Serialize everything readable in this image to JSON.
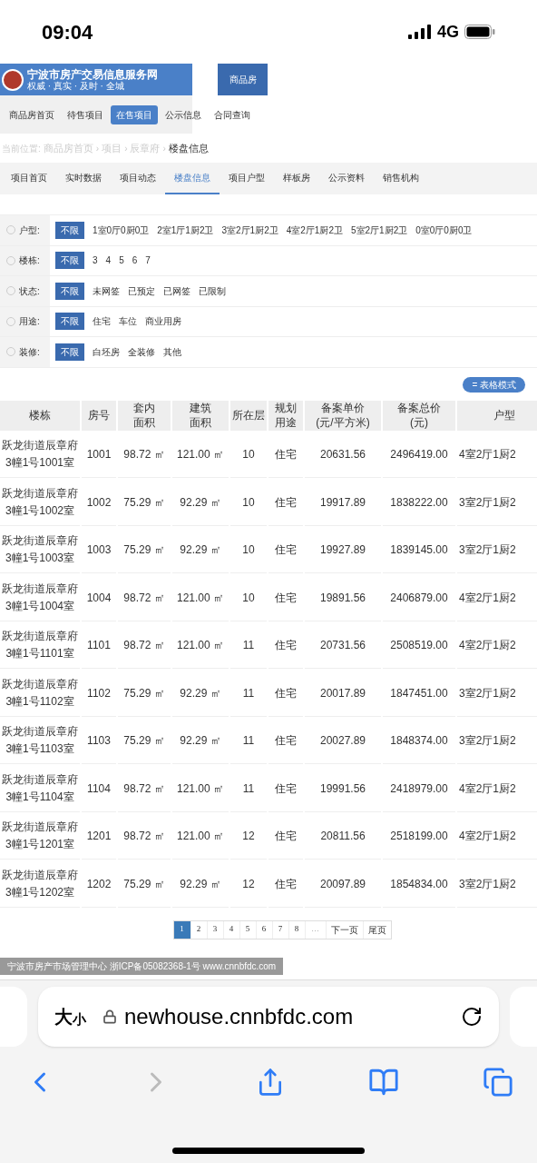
{
  "status_bar": {
    "time": "09:04",
    "network": "4G"
  },
  "site_header": {
    "title": "宁波市房产交易信息服务网",
    "slogan": "权威 · 真实 · 及时 · 全城",
    "nav_tab": "商品房"
  },
  "main_nav": [
    {
      "label": "商品房首页",
      "selected": false
    },
    {
      "label": "待售项目",
      "selected": false
    },
    {
      "label": "在售项目",
      "selected": true
    },
    {
      "label": "公示信息",
      "selected": false
    },
    {
      "label": "合同查询",
      "selected": false
    }
  ],
  "breadcrumb": {
    "prefix": "当前位置:",
    "separator": "›",
    "items": [
      "商品房首页",
      "项目",
      "辰章府",
      "楼盘信息"
    ]
  },
  "project_tabs": [
    {
      "label": "项目首页",
      "selected": false
    },
    {
      "label": "实时数据",
      "selected": false
    },
    {
      "label": "项目动态",
      "selected": false
    },
    {
      "label": "楼盘信息",
      "selected": true
    },
    {
      "label": "项目户型",
      "selected": false
    },
    {
      "label": "样板房",
      "selected": false
    },
    {
      "label": "公示资料",
      "selected": false
    },
    {
      "label": "销售机构",
      "selected": false
    }
  ],
  "filters": [
    {
      "label": "户型:",
      "options": [
        {
          "label": "不限",
          "selected": true
        },
        {
          "label": "1室0厅0厨0卫",
          "selected": false
        },
        {
          "label": "2室1厅1厨2卫",
          "selected": false
        },
        {
          "label": "3室2厅1厨2卫",
          "selected": false
        },
        {
          "label": "4室2厅1厨2卫",
          "selected": false
        },
        {
          "label": "5室2厅1厨2卫",
          "selected": false
        },
        {
          "label": "0室0厅0厨0卫",
          "selected": false
        }
      ]
    },
    {
      "label": "楼栋:",
      "options": [
        {
          "label": "不限",
          "selected": true
        },
        {
          "label": "3",
          "selected": false
        },
        {
          "label": "4",
          "selected": false
        },
        {
          "label": "5",
          "selected": false
        },
        {
          "label": "6",
          "selected": false
        },
        {
          "label": "7",
          "selected": false
        }
      ]
    },
    {
      "label": "状态:",
      "options": [
        {
          "label": "不限",
          "selected": true
        },
        {
          "label": "未网签",
          "selected": false
        },
        {
          "label": "已预定",
          "selected": false
        },
        {
          "label": "已网签",
          "selected": false
        },
        {
          "label": "已限制",
          "selected": false
        }
      ]
    },
    {
      "label": "用途:",
      "options": [
        {
          "label": "不限",
          "selected": true
        },
        {
          "label": "住宅",
          "selected": false
        },
        {
          "label": "车位",
          "selected": false
        },
        {
          "label": "商业用房",
          "selected": false
        }
      ]
    },
    {
      "label": "装修:",
      "options": [
        {
          "label": "不限",
          "selected": true
        },
        {
          "label": "白坯房",
          "selected": false
        },
        {
          "label": "全装修",
          "selected": false
        },
        {
          "label": "其他",
          "selected": false
        }
      ]
    }
  ],
  "view_toggle": "= 表格模式",
  "table": {
    "columns": [
      "楼栋",
      "房号",
      "套内面积",
      "建筑面积",
      "所在层",
      "规划用途",
      "备案单价\n(元/平方米)",
      "备案总价\n(元)",
      "户型"
    ],
    "rows": [
      [
        "跃龙街道辰章府3幢1号1001室",
        "1001",
        "98.72 ㎡",
        "121.00 ㎡",
        "10",
        "住宅",
        "20631.56",
        "2496419.00",
        "4室2厅1厨2"
      ],
      [
        "跃龙街道辰章府3幢1号1002室",
        "1002",
        "75.29 ㎡",
        "92.29 ㎡",
        "10",
        "住宅",
        "19917.89",
        "1838222.00",
        "3室2厅1厨2"
      ],
      [
        "跃龙街道辰章府3幢1号1003室",
        "1003",
        "75.29 ㎡",
        "92.29 ㎡",
        "10",
        "住宅",
        "19927.89",
        "1839145.00",
        "3室2厅1厨2"
      ],
      [
        "跃龙街道辰章府3幢1号1004室",
        "1004",
        "98.72 ㎡",
        "121.00 ㎡",
        "10",
        "住宅",
        "19891.56",
        "2406879.00",
        "4室2厅1厨2"
      ],
      [
        "跃龙街道辰章府3幢1号1101室",
        "1101",
        "98.72 ㎡",
        "121.00 ㎡",
        "11",
        "住宅",
        "20731.56",
        "2508519.00",
        "4室2厅1厨2"
      ],
      [
        "跃龙街道辰章府3幢1号1102室",
        "1102",
        "75.29 ㎡",
        "92.29 ㎡",
        "11",
        "住宅",
        "20017.89",
        "1847451.00",
        "3室2厅1厨2"
      ],
      [
        "跃龙街道辰章府3幢1号1103室",
        "1103",
        "75.29 ㎡",
        "92.29 ㎡",
        "11",
        "住宅",
        "20027.89",
        "1848374.00",
        "3室2厅1厨2"
      ],
      [
        "跃龙街道辰章府3幢1号1104室",
        "1104",
        "98.72 ㎡",
        "121.00 ㎡",
        "11",
        "住宅",
        "19991.56",
        "2418979.00",
        "4室2厅1厨2"
      ],
      [
        "跃龙街道辰章府3幢1号1201室",
        "1201",
        "98.72 ㎡",
        "121.00 ㎡",
        "12",
        "住宅",
        "20811.56",
        "2518199.00",
        "4室2厅1厨2"
      ],
      [
        "跃龙街道辰章府3幢1号1202室",
        "1202",
        "75.29 ㎡",
        "92.29 ㎡",
        "12",
        "住宅",
        "20097.89",
        "1854834.00",
        "3室2厅1厨2"
      ]
    ]
  },
  "pagination": {
    "pages": [
      {
        "label": "1",
        "selected": true
      },
      {
        "label": "2",
        "selected": false
      },
      {
        "label": "3",
        "selected": false
      },
      {
        "label": "4",
        "selected": false
      },
      {
        "label": "5",
        "selected": false
      },
      {
        "label": "6",
        "selected": false
      },
      {
        "label": "7",
        "selected": false
      },
      {
        "label": "8",
        "selected": false
      }
    ],
    "ellipsis": "…",
    "next": "下一页",
    "last": "尾页"
  },
  "footer": "宁波市房产市场管理中心 浙ICP备05082368-1号 www.cnnbfdc.com",
  "browser": {
    "text_size": {
      "large": "大",
      "small": "小"
    },
    "url": "newhouse.cnnbfdc.com"
  }
}
